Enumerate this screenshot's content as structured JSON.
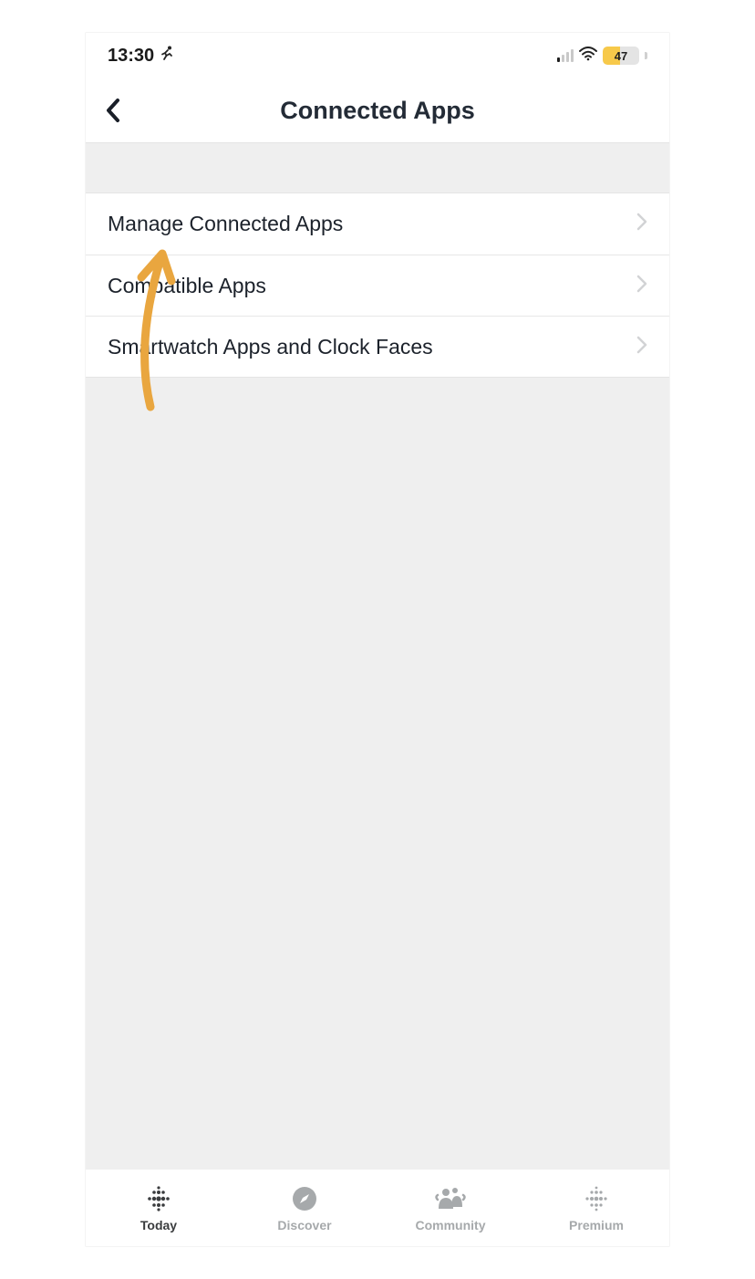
{
  "statusBar": {
    "time": "13:30",
    "runningIcon": "running-person",
    "battery": "47"
  },
  "header": {
    "title": "Connected Apps"
  },
  "list": {
    "items": [
      {
        "label": "Manage Connected Apps"
      },
      {
        "label": "Compatible Apps"
      },
      {
        "label": "Smartwatch Apps and Clock Faces"
      }
    ]
  },
  "tabbar": {
    "tabs": [
      {
        "label": "Today",
        "active": true
      },
      {
        "label": "Discover",
        "active": false
      },
      {
        "label": "Community",
        "active": false
      },
      {
        "label": "Premium",
        "active": false
      }
    ]
  },
  "annotation": {
    "color": "#e9a63f"
  }
}
